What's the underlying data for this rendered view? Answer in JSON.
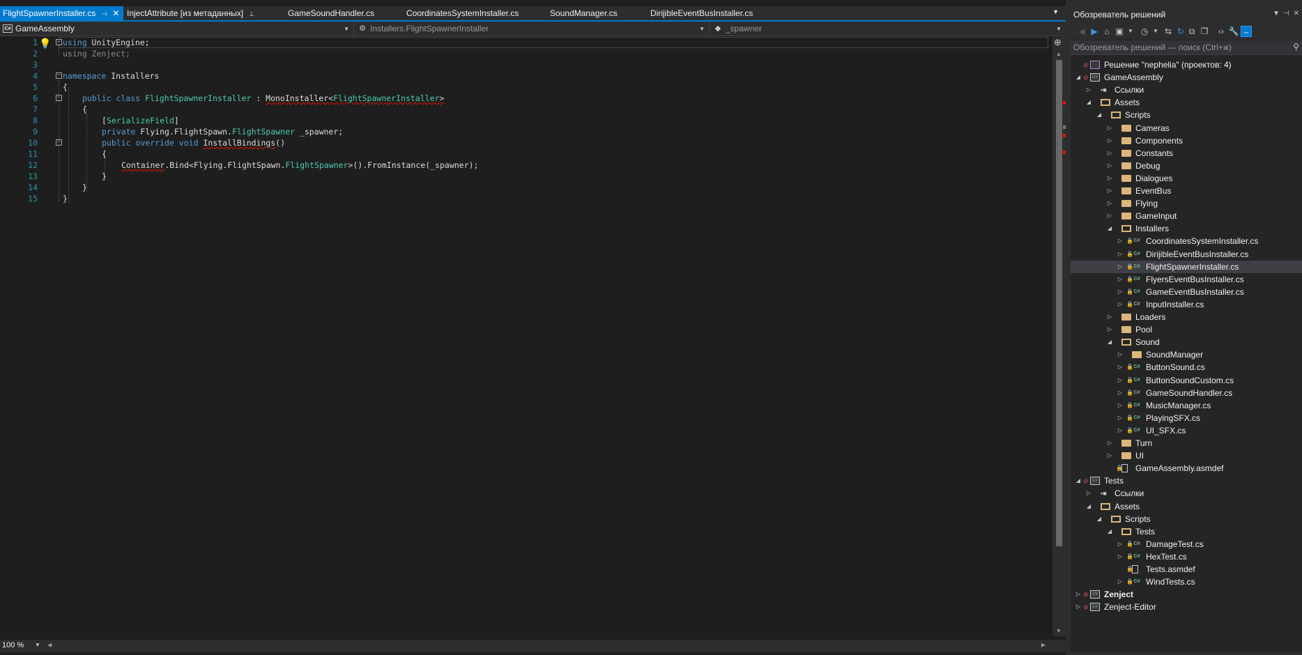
{
  "tabs": [
    {
      "label": "FlightSpawnerInstaller.cs",
      "active": true
    },
    {
      "label": "InjectAttribute [из метаданных]",
      "pinned": true
    },
    {
      "label": "GameSoundHandler.cs"
    },
    {
      "label": "CoordinatesSystemInstaller.cs"
    },
    {
      "label": "SoundManager.cs"
    },
    {
      "label": "DirijibleEventBusInstaller.cs"
    }
  ],
  "navbar": {
    "project": "GameAssembly",
    "type": "Installers.FlightSpawnerInstaller",
    "member": "_spawner"
  },
  "code": {
    "line_numbers": [
      "1",
      "2",
      "3",
      "4",
      "5",
      "6",
      "7",
      "8",
      "9",
      "10",
      "11",
      "12",
      "13",
      "14",
      "15"
    ],
    "l1_kw": "using",
    "l1_rest": " UnityEngine;",
    "l2_kw": "using",
    "l2_rest": " Zenject;",
    "l4_kw": "namespace",
    "l4_rest": " Installers",
    "l5": "{",
    "l6_kw": "public class",
    "l6_a": " ",
    "l6_name": "FlightSpawnerInstaller",
    "l6_b": " : ",
    "l6_base": "MonoInstaller",
    "l6_lt": "<",
    "l6_gen": "FlightSpawnerInstaller",
    "l6_gt": ">",
    "l7": "{",
    "l8_open": "[",
    "l8_attr": "SerializeField",
    "l8_close": "]",
    "l9_kw": "private",
    "l9_a": " Flying.FlightSpawn.",
    "l9_ty": "FlightSpawner",
    "l9_b": " _spawner;",
    "l10_kw": "public override void",
    "l10_a": " ",
    "l10_name": "InstallBindings",
    "l10_b": "()",
    "l11": "{",
    "l12_a": "Container",
    "l12_b": ".Bind<Flying.FlightSpawn.",
    "l12_ty": "FlightSpawner",
    "l12_c": ">().FromInstance(_spawner);",
    "l13": "}",
    "l14": "}",
    "l15": "}"
  },
  "status": {
    "zoom": "100 %"
  },
  "solution_explorer": {
    "title": "Обозреватель решений",
    "search_placeholder": "Обозреватель решений — поиск (Ctrl+ж)",
    "tree": [
      {
        "label": "Решение \"nephelia\"  (проектов: 4)"
      },
      {
        "label": "GameAssembly"
      },
      {
        "label": "Ссылки"
      },
      {
        "label": "Assets"
      },
      {
        "label": "Scripts"
      },
      {
        "label": "Cameras"
      },
      {
        "label": "Components"
      },
      {
        "label": "Constants"
      },
      {
        "label": "Debug"
      },
      {
        "label": "Dialogues"
      },
      {
        "label": "EventBus"
      },
      {
        "label": "Flying"
      },
      {
        "label": "GameInput"
      },
      {
        "label": "Installers"
      },
      {
        "label": "CoordinatesSystemInstaller.cs"
      },
      {
        "label": "DirijibleEventBusInstaller.cs"
      },
      {
        "label": "FlightSpawnerInstaller.cs"
      },
      {
        "label": "FlyersEventBusInstaller.cs"
      },
      {
        "label": "GameEventBusInstaller.cs"
      },
      {
        "label": "InputInstaller.cs"
      },
      {
        "label": "Loaders"
      },
      {
        "label": "Pool"
      },
      {
        "label": "Sound"
      },
      {
        "label": "SoundManager"
      },
      {
        "label": "ButtonSound.cs"
      },
      {
        "label": "ButtonSoundCustom.cs"
      },
      {
        "label": "GameSoundHandler.cs"
      },
      {
        "label": "MusicManager.cs"
      },
      {
        "label": "PlayingSFX.cs"
      },
      {
        "label": "UI_SFX.cs"
      },
      {
        "label": "Turn"
      },
      {
        "label": "UI"
      },
      {
        "label": "GameAssembly.asmdef"
      },
      {
        "label": "Tests"
      },
      {
        "label": "Ссылки"
      },
      {
        "label": "Assets"
      },
      {
        "label": "Scripts"
      },
      {
        "label": "Tests"
      },
      {
        "label": "DamageTest.cs"
      },
      {
        "label": "HexTest.cs"
      },
      {
        "label": "Tests.asmdef"
      },
      {
        "label": "WindTests.cs"
      },
      {
        "label": "Zenject"
      },
      {
        "label": "Zenject-Editor"
      }
    ]
  },
  "colors": {
    "accent": "#007acc",
    "editor_bg": "#1e1e1e",
    "keyword": "#569cd6",
    "type": "#4ec9b0",
    "line_number": "#2b91af",
    "error": "#e51400"
  }
}
